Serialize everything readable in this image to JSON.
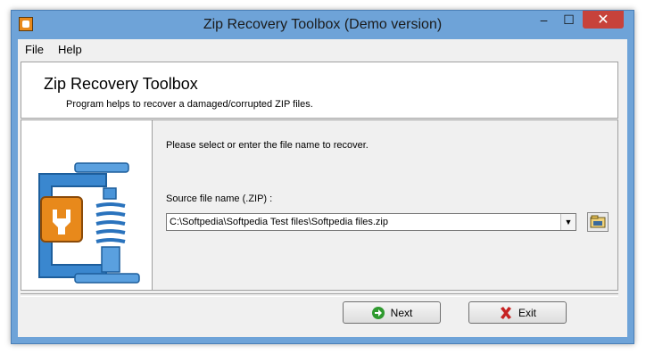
{
  "window": {
    "title": "Zip Recovery Toolbox (Demo version)",
    "controls": {
      "minimize_glyph": "‒",
      "maximize_glyph": "☐",
      "close_glyph": "✕"
    }
  },
  "menu": {
    "items": [
      {
        "label": "File"
      },
      {
        "label": "Help"
      }
    ]
  },
  "header": {
    "title": "Zip Recovery Toolbox",
    "subtitle": "Program helps to recover a damaged/corrupted ZIP files."
  },
  "main": {
    "instruction": "Please select or enter the file name to recover.",
    "source_label": "Source file name (.ZIP) :",
    "source_value": "C:\\Softpedia\\Softpedia Test files\\Softpedia files.zip",
    "dropdown_glyph": "▼"
  },
  "buttons": {
    "next_label": "Next",
    "exit_label": "Exit"
  },
  "icons": {
    "app": "app-icon",
    "logo": "wrench-clamp-logo",
    "browse": "folder-browse-icon",
    "next": "green-arrow-icon",
    "exit": "red-x-icon"
  },
  "colors": {
    "title_bar": "#6ea3d8",
    "close_button": "#c7423b",
    "logo_orange": "#e8891b",
    "logo_blue": "#3a87cf",
    "next_icon": "#2f9a2f",
    "exit_icon": "#c62121"
  }
}
